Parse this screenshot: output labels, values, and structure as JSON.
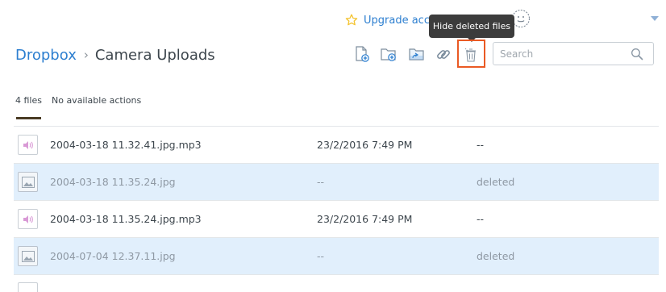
{
  "header": {
    "upgrade_label": "Upgrade acco",
    "tooltip": "Hide deleted files"
  },
  "breadcrumb": {
    "root": "Dropbox",
    "separator": "›",
    "current": "Camera Uploads"
  },
  "toolbar": {
    "icons": [
      "new-file-icon",
      "new-folder-icon",
      "new-shared-folder-icon",
      "share-link-icon",
      "show-deleted-files-icon"
    ],
    "highlight_color": "#ea5a24"
  },
  "search": {
    "placeholder": "Search",
    "value": ""
  },
  "meta": {
    "file_count": "4 files",
    "actions": "No available actions"
  },
  "files": [
    {
      "name": "2004-03-18 11.32.41.jpg.mp3",
      "modified": "23/2/2016 7:49 PM",
      "status": "--",
      "type": "audio",
      "deleted": false
    },
    {
      "name": "2004-03-18 11.35.24.jpg",
      "modified": "--",
      "status": "deleted",
      "type": "image",
      "deleted": true
    },
    {
      "name": "2004-03-18 11.35.24.jpg.mp3",
      "modified": "23/2/2016 7:49 PM",
      "status": "--",
      "type": "audio",
      "deleted": false
    },
    {
      "name": "2004-07-04 12.37.11.jpg",
      "modified": "--",
      "status": "deleted",
      "type": "image",
      "deleted": true
    }
  ],
  "colors": {
    "link": "#2d7fd0",
    "deleted_row_bg": "#e1effc",
    "star": "#f4c431"
  }
}
